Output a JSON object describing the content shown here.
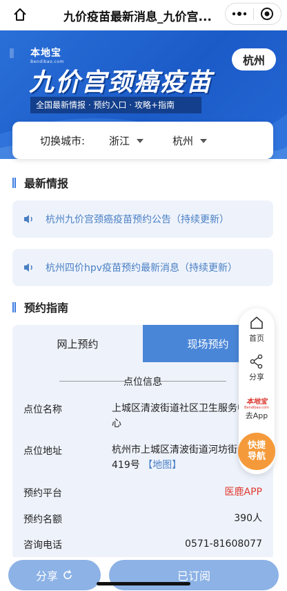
{
  "window": {
    "title": "九价疫苗最新消息_九价宫..."
  },
  "banner": {
    "logo_cn": "本地宝",
    "logo_en": "Bendibao.com",
    "headline": "九价宫颈癌疫苗",
    "tagline": "全国最新情报 · 预约入口 · 攻略+指南",
    "city_pill": "杭州"
  },
  "city_switch": {
    "label": "切换城市:",
    "province": "浙江",
    "city": "杭州"
  },
  "news_section": {
    "heading": "最新情报",
    "items": [
      {
        "text": "杭州九价宫颈癌疫苗预约公告（持续更新）"
      },
      {
        "text": "杭州四价hpv疫苗预约最新消息（持续更新）"
      }
    ]
  },
  "guide_section": {
    "heading": "预约指南",
    "tabs": [
      "网上预约",
      "现场预约"
    ],
    "sub_heading": "点位信息",
    "rows": [
      {
        "label": "点位名称",
        "value": "上城区清波街道社区卫生服务中心"
      },
      {
        "label": "点位地址",
        "value": "杭州市上城区清波街道河坊街419号",
        "link": "【地图】"
      },
      {
        "label": "预约平台",
        "value": "医鹿APP"
      },
      {
        "label": "预约名额",
        "value": "390人"
      },
      {
        "label": "咨询电话",
        "value": "0571-81608077"
      }
    ]
  },
  "float_nav": {
    "home": "首页",
    "share": "分享",
    "bendibao_logo": "本地宝",
    "bendibao_sub": "Bendibao.com",
    "app": "去App",
    "quick_nav": [
      "快捷",
      "导航"
    ]
  },
  "bottom_bar": {
    "share": "分享",
    "subscribed": "已订阅"
  },
  "colors": {
    "brand_blue": "#1b5bc8",
    "tab_active": "#4a86d8",
    "link": "#4a7fc4",
    "quick_nav": "#f59a3a",
    "platform_red": "#e0382f"
  }
}
